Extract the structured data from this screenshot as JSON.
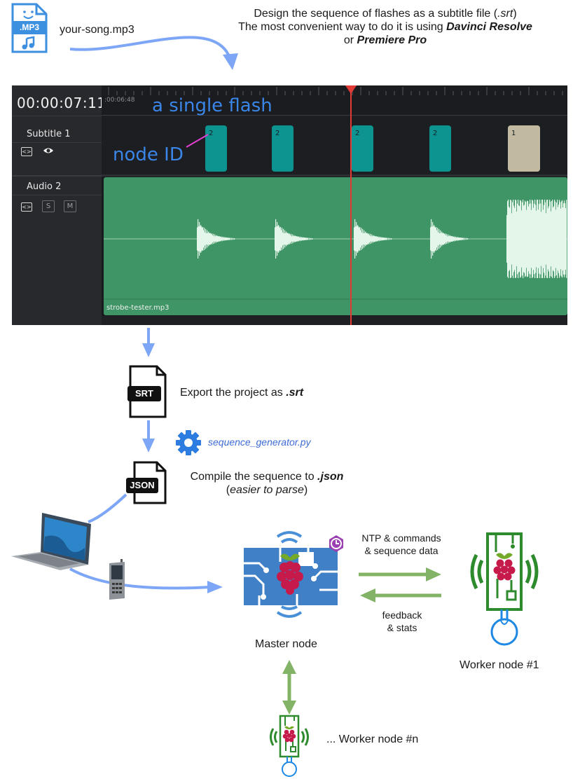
{
  "top": {
    "mp3_badge": ".MP3",
    "song_file": "your-song.mp3",
    "instructions": {
      "line1_prefix": "Design the sequence of flashes as a subtitle file (",
      "line1_ext": ".srt",
      "line1_suffix": ")",
      "line2_prefix": "The most convenient way to do it is using ",
      "line2_app": "Davinci Resolve",
      "line3_prefix": "or ",
      "line3_app": "Premiere Pro"
    }
  },
  "editor": {
    "timecode": "00:00:07:11",
    "ruler_time": ":00:06:48",
    "subtitle_track": "Subtitle 1",
    "audio_track": "Audio 2",
    "solo_btn": "S",
    "mute_btn": "M",
    "audio_clip_name": "strobe-tester.mp3",
    "annotation_flash": "a single flash",
    "annotation_node": "node ID",
    "clips": [
      {
        "id": "2",
        "color": "#0d9390"
      },
      {
        "id": "2",
        "color": "#0d9390"
      },
      {
        "id": "2",
        "color": "#0d9390"
      },
      {
        "id": "2",
        "color": "#0d9390"
      },
      {
        "id": "1",
        "color": "#c2b9a3"
      }
    ],
    "playhead_color": "#e23b35",
    "audio_color": "#3f9566"
  },
  "pipeline": {
    "srt_label": "SRT",
    "export_prefix": "Export the project as ",
    "export_ext": ".srt",
    "script_name": "sequence_generator.py",
    "json_label": "JSON",
    "compile_prefix": "Compile the sequence to ",
    "compile_ext": ".json",
    "compile_note_open": "(",
    "compile_note": "easier to parse",
    "compile_note_close": ")"
  },
  "network": {
    "master_label": "Master node",
    "ntp_line1": "NTP & commands",
    "ntp_line2": "& sequence data",
    "feedback_line1": "feedback",
    "feedback_line2": "& stats",
    "worker1_label": "Worker node #1",
    "workern_label": "... Worker node #n"
  },
  "colors": {
    "flow_arrow": "#7ea6f6",
    "green_arrow": "#82b366",
    "annotation_blue": "#3a86e8",
    "script_blue": "#3d6bd6",
    "worker_green": "#2d8a2d",
    "bulb_blue": "#1e88e5",
    "pi_red": "#c51a4a",
    "pi_leaf": "#75a928"
  }
}
